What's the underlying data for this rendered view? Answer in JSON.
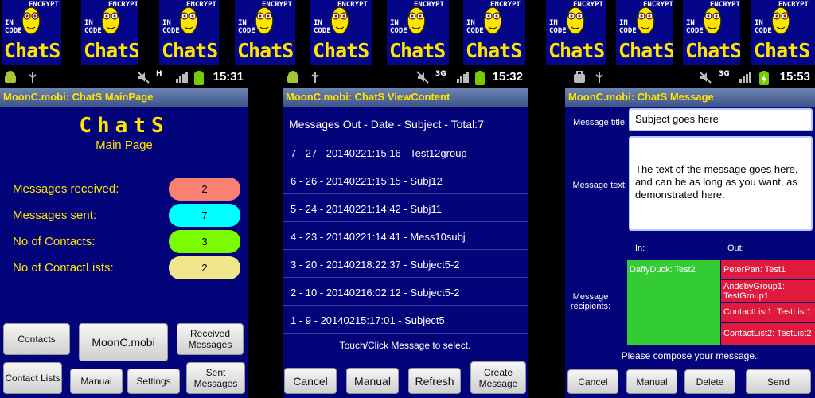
{
  "logo": {
    "enc": "ENCRYPT",
    "in": "IN",
    "code": "CODE",
    "name": "ChatS"
  },
  "phones": [
    {
      "status": {
        "time": "15:31"
      },
      "title": "MoonC.mobi: ChatS MainPage",
      "main": {
        "app_title": "ChatS",
        "subtitle": "Main Page",
        "stats": [
          {
            "label": "Messages received:",
            "value": "2",
            "color": "#fa8072"
          },
          {
            "label": "Messages sent:",
            "value": "7",
            "color": "#00ffff"
          },
          {
            "label": "No of Contacts:",
            "value": "3",
            "color": "#7cfc00"
          },
          {
            "label": "No of ContactLists:",
            "value": "2",
            "color": "#f0e68c"
          }
        ]
      },
      "buttons": {
        "contacts": "Contacts",
        "moonc": "MoonC.mobi",
        "received": "Received Messages",
        "contact_lists": "Contact Lists",
        "manual": "Manual",
        "settings": "Settings",
        "sent": "Sent Messages"
      }
    },
    {
      "status": {
        "time": "15:32"
      },
      "title": "MoonC.mobi: ChatS ViewContent",
      "header": "Messages Out - Date - Subject - Total:7",
      "messages": [
        "7 -   27 - 20140221:15:16 - Test12group",
        "6 -   26 - 20140221:15:15 - Subj12",
        "5 -   24 - 20140221:14:42 - Subj11",
        "4 -   23 - 20140221:14:41 - Mess10subj",
        "3 -   20 - 20140218:22:37 - Subject5-2",
        "2 -   10 - 20140216:02:12 - Subject5-2",
        "1 -   9 - 20140215:17:01 - Subject5"
      ],
      "hint": "Touch/Click Message to select.",
      "buttons": {
        "cancel": "Cancel",
        "manual": "Manual",
        "refresh": "Refresh",
        "create": "Create Message"
      }
    },
    {
      "status": {
        "time": "15:53"
      },
      "title": "MoonC.mobi: ChatS Message",
      "labels": {
        "title": "Message title:",
        "text": "Message text:",
        "in": "In:",
        "out": "Out:",
        "recipients": "Message recipients:"
      },
      "title_value": "Subject goes here",
      "text_value": "The text of the message goes here, and can be as long as you want, as demonstrated here.",
      "recipients_in": [
        "DaffyDuck: Test2"
      ],
      "recipients_out": [
        "PeterPan: Test1",
        "AndebyGroup1: TestGroup1",
        "ContactList1: TestList1",
        "ContactList2: TestList2"
      ],
      "compose": "Please compose your message.",
      "buttons": {
        "cancel": "Cancel",
        "manual": "Manual",
        "delete": "Delete",
        "send": "Send"
      },
      "colors": {
        "in": "#33cc33",
        "out": "#e01a3c"
      }
    }
  ]
}
